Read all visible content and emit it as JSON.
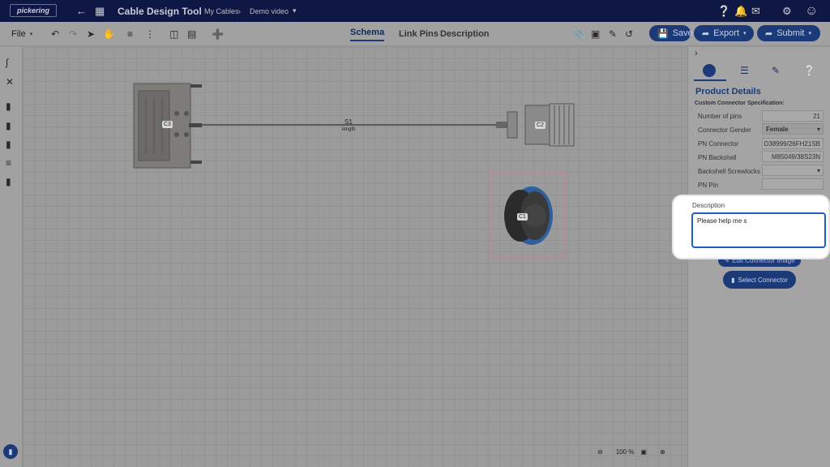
{
  "topbar": {
    "logo": "pickering",
    "app_title": "Cable Design Tool",
    "breadcrumb": [
      "My Cables",
      "Demo video"
    ],
    "icons": [
      "back-arrow-icon",
      "apps-grid-icon",
      "help-icon",
      "bell-icon",
      "messages-icon",
      "settings-icon",
      "account-icon"
    ]
  },
  "toolbar": {
    "file_label": "File",
    "tabs": [
      {
        "label": "Schema",
        "active": true
      },
      {
        "label": "Link Pins",
        "active": false
      },
      {
        "label": "Description",
        "active": false
      }
    ],
    "save_label": "Save",
    "export_label": "Export",
    "submit_label": "Submit"
  },
  "canvas": {
    "connectors": [
      "C3",
      "C2",
      "C1"
    ],
    "wire": {
      "name": "S1",
      "sub": "length"
    },
    "zoom": "100 %"
  },
  "right_panel": {
    "title": "Product Details",
    "subtitle": "Custom Connector Specification:",
    "rows": [
      {
        "label": "Number of pins",
        "value": "21",
        "type": "text"
      },
      {
        "label": "Connector Gender",
        "value": "Female",
        "type": "select"
      },
      {
        "label": "PN Connector",
        "value": "D38999/26FH21SB",
        "type": "text"
      },
      {
        "label": "PN Backshell",
        "value": "M85049/38S23N",
        "type": "text"
      },
      {
        "label": "Backshell Screwlocks",
        "value": "",
        "type": "select"
      },
      {
        "label": "PN Pin",
        "value": "",
        "type": "text"
      }
    ],
    "description_label": "Description",
    "description_value": "Please help me s",
    "edit_image_label": "Edit Connector Image",
    "select_connector_label": "Select Connector"
  },
  "colors": {
    "nav": "#0f1744",
    "accent": "#1c3a78",
    "focus": "#1f5fbf"
  }
}
